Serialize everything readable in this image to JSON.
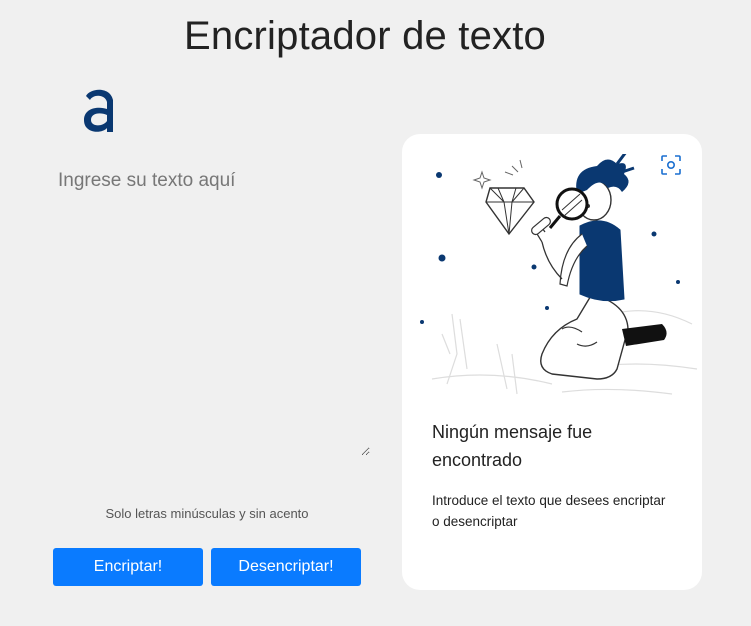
{
  "header": {
    "title": "Encriptador de texto"
  },
  "brand": {
    "logo_icon": "alura-a-logo",
    "logo_color": "#0a3871"
  },
  "input": {
    "placeholder": "Ingrese su texto aquí",
    "value": ""
  },
  "hint": {
    "text": "Solo letras minúsculas y sin acento"
  },
  "buttons": {
    "encrypt_label": "Encriptar!",
    "decrypt_label": "Desencriptar!",
    "color": "#0a7bff"
  },
  "output_card": {
    "illustration_icon": "person-with-magnifier-illustration",
    "scan_icon": "scan-focus-icon",
    "title": "Ningún mensaje fue encontrado",
    "text": "Introduce el texto que desees encriptar o desencriptar"
  }
}
